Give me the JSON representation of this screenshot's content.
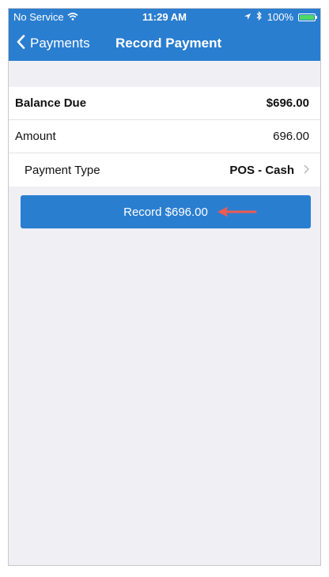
{
  "status_bar": {
    "carrier": "No Service",
    "time": "11:29 AM",
    "battery": "100%"
  },
  "nav": {
    "back_label": "Payments",
    "title": "Record Payment"
  },
  "rows": [
    {
      "label": "Balance Due",
      "value": "$696.00"
    },
    {
      "label": "Amount",
      "value": "696.00"
    },
    {
      "label": "Payment Type",
      "value": "POS - Cash"
    }
  ],
  "record_button": {
    "label": "Record $696.00"
  },
  "colors": {
    "nav_bg": "#2a7ed0",
    "background": "#efeff4",
    "arrow": "#f05a4f",
    "battery": "#4cd964"
  },
  "icons": [
    "wifi-icon",
    "location-icon",
    "bluetooth-icon",
    "battery-icon",
    "chevron-left-icon",
    "chevron-right-icon",
    "arrow-left-icon"
  ]
}
